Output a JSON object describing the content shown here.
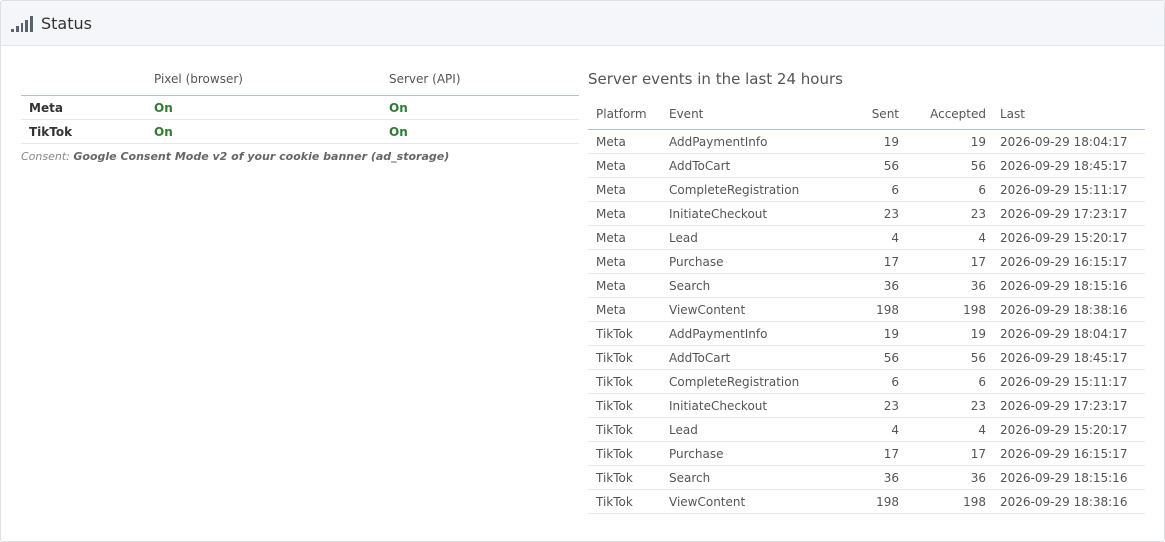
{
  "header": {
    "title": "Status",
    "icon": "signal-bars-icon"
  },
  "status": {
    "columns": [
      "Pixel (browser)",
      "Server (API)"
    ],
    "rows": [
      {
        "platform": "Meta",
        "pixel": "On",
        "server": "On"
      },
      {
        "platform": "TikTok",
        "pixel": "On",
        "server": "On"
      }
    ],
    "consent_label": "Consent:",
    "consent_value": "Google Consent Mode v2 of your cookie banner (ad_storage)"
  },
  "events": {
    "title": "Server events in the last 24 hours",
    "columns": {
      "platform": "Platform",
      "event": "Event",
      "sent": "Sent",
      "accepted": "Accepted",
      "last": "Last"
    },
    "rows": [
      {
        "platform": "Meta",
        "event": "AddPaymentInfo",
        "sent": "19",
        "accepted": "19",
        "last": "2026-09-29 18:04:17"
      },
      {
        "platform": "Meta",
        "event": "AddToCart",
        "sent": "56",
        "accepted": "56",
        "last": "2026-09-29 18:45:17"
      },
      {
        "platform": "Meta",
        "event": "CompleteRegistration",
        "sent": "6",
        "accepted": "6",
        "last": "2026-09-29 15:11:17"
      },
      {
        "platform": "Meta",
        "event": "InitiateCheckout",
        "sent": "23",
        "accepted": "23",
        "last": "2026-09-29 17:23:17"
      },
      {
        "platform": "Meta",
        "event": "Lead",
        "sent": "4",
        "accepted": "4",
        "last": "2026-09-29 15:20:17"
      },
      {
        "platform": "Meta",
        "event": "Purchase",
        "sent": "17",
        "accepted": "17",
        "last": "2026-09-29 16:15:17"
      },
      {
        "platform": "Meta",
        "event": "Search",
        "sent": "36",
        "accepted": "36",
        "last": "2026-09-29 18:15:16"
      },
      {
        "platform": "Meta",
        "event": "ViewContent",
        "sent": "198",
        "accepted": "198",
        "last": "2026-09-29 18:38:16"
      },
      {
        "platform": "TikTok",
        "event": "AddPaymentInfo",
        "sent": "19",
        "accepted": "19",
        "last": "2026-09-29 18:04:17"
      },
      {
        "platform": "TikTok",
        "event": "AddToCart",
        "sent": "56",
        "accepted": "56",
        "last": "2026-09-29 18:45:17"
      },
      {
        "platform": "TikTok",
        "event": "CompleteRegistration",
        "sent": "6",
        "accepted": "6",
        "last": "2026-09-29 15:11:17"
      },
      {
        "platform": "TikTok",
        "event": "InitiateCheckout",
        "sent": "23",
        "accepted": "23",
        "last": "2026-09-29 17:23:17"
      },
      {
        "platform": "TikTok",
        "event": "Lead",
        "sent": "4",
        "accepted": "4",
        "last": "2026-09-29 15:20:17"
      },
      {
        "platform": "TikTok",
        "event": "Purchase",
        "sent": "17",
        "accepted": "17",
        "last": "2026-09-29 16:15:17"
      },
      {
        "platform": "TikTok",
        "event": "Search",
        "sent": "36",
        "accepted": "36",
        "last": "2026-09-29 18:15:16"
      },
      {
        "platform": "TikTok",
        "event": "ViewContent",
        "sent": "198",
        "accepted": "198",
        "last": "2026-09-29 18:38:16"
      }
    ]
  }
}
